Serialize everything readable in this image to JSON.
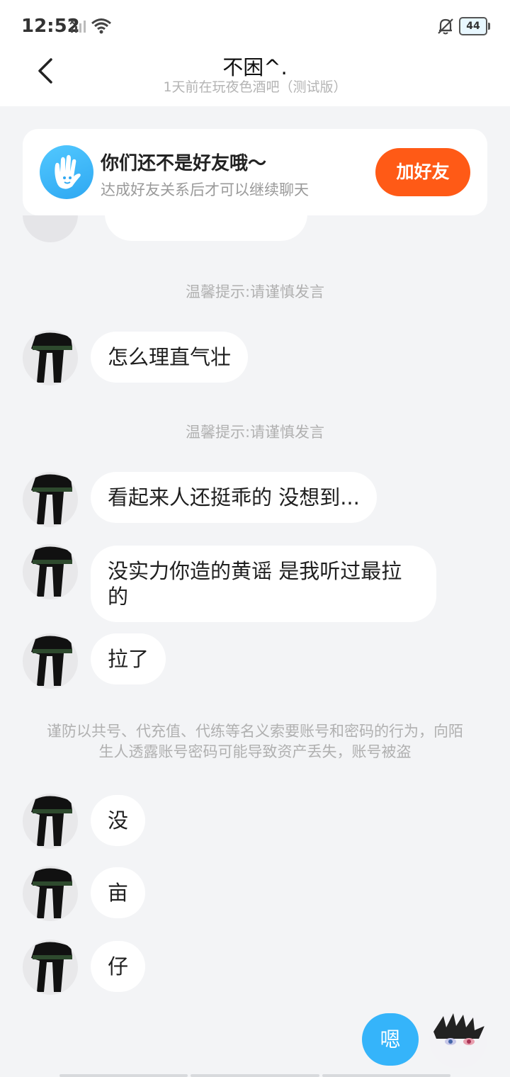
{
  "status_bar": {
    "time": "12:52",
    "battery": "44"
  },
  "header": {
    "title": "不困^.",
    "subtitle": "1天前在玩夜色酒吧（测试版）"
  },
  "friend_banner": {
    "title": "你们还不是好友哦～",
    "subtitle": "达成好友关系后才可以继续聊天",
    "button": "加好友"
  },
  "tips": {
    "tip_1": "温馨提示:请谨慎发言",
    "tip_2": "温馨提示:请谨慎发言",
    "security_notice": "谨防以共号、代充值、代练等名义索要账号和密码的行为，向陌生人透露账号密码可能导致资产丢失，账号被盗"
  },
  "messages": [
    {
      "text": "怎么理直气壮"
    },
    {
      "text": "看起来人还挺乖的 没想到..."
    },
    {
      "text": "没实力你造的黄谣 是我听过最拉的"
    },
    {
      "text": "拉了"
    },
    {
      "text": "没"
    },
    {
      "text": "亩"
    },
    {
      "text": "仔"
    }
  ],
  "self_message": {
    "text": "嗯"
  },
  "colors": {
    "accent_orange": "#ff5a16",
    "self_bubble_blue": "#35b4fa",
    "background": "#f3f4f6"
  }
}
